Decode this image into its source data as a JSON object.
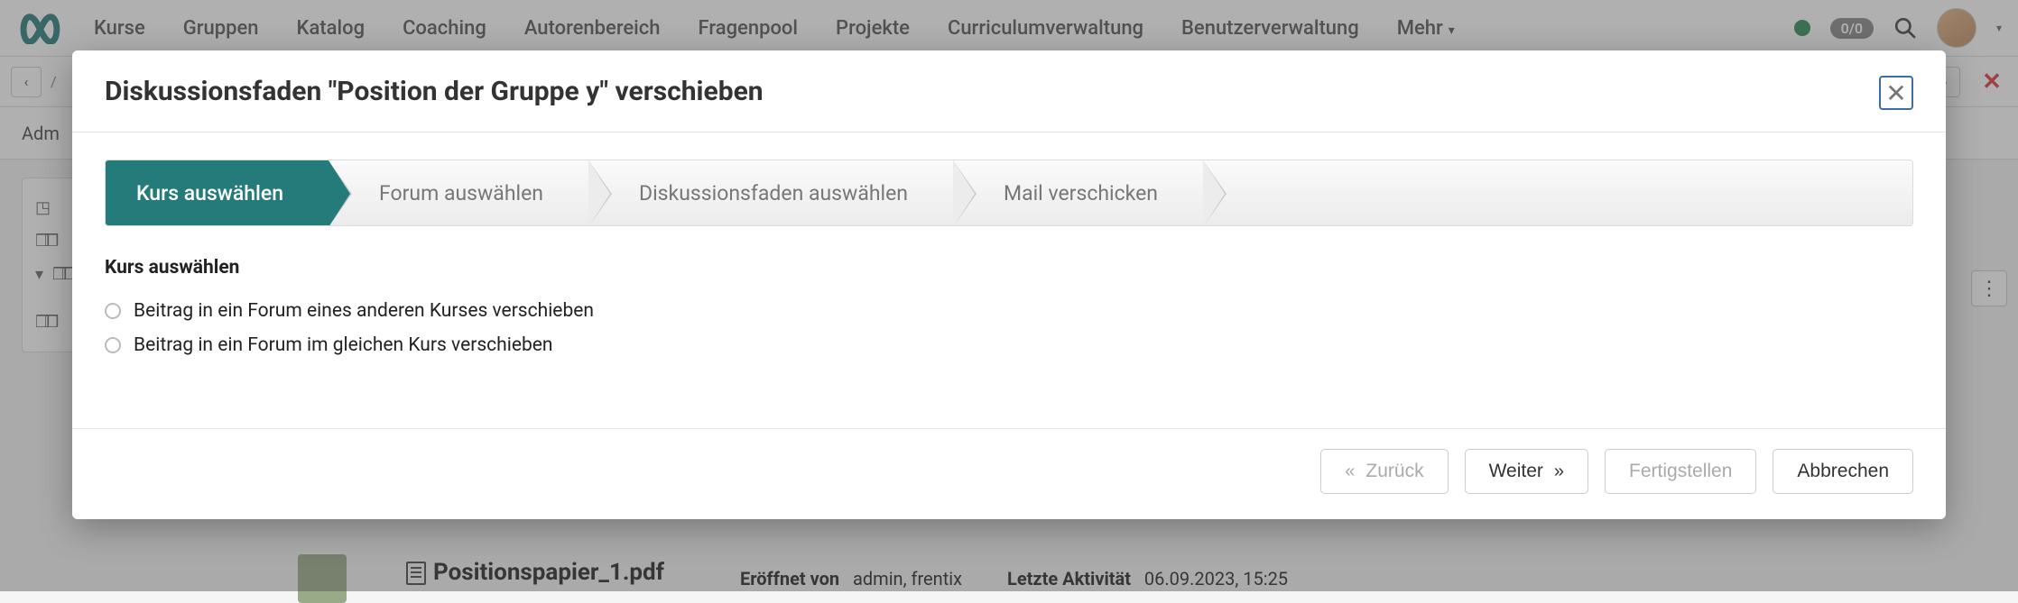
{
  "nav": {
    "items": [
      "Kurse",
      "Gruppen",
      "Katalog",
      "Coaching",
      "Autorenbereich",
      "Fragenpool",
      "Projekte",
      "Curriculumverwaltung",
      "Benutzerverwaltung"
    ],
    "more_label": "Mehr",
    "badge": "0/0"
  },
  "subbar": {
    "label": "Adm"
  },
  "background": {
    "doc_title": "Positionspapier_1.pdf",
    "opened_by_label": "Eröffnet von",
    "opened_by_value": "admin, frentix",
    "last_activity_label": "Letzte Aktivität",
    "last_activity_value": "06.09.2023, 15:25"
  },
  "modal": {
    "title": "Diskussionsfaden \"Position der Gruppe y\" verschieben",
    "steps": [
      "Kurs auswählen",
      "Forum auswählen",
      "Diskussionsfaden auswählen",
      "Mail verschicken"
    ],
    "active_step_index": 0,
    "section_heading": "Kurs auswählen",
    "options": [
      "Beitrag in ein Forum eines anderen Kurses verschieben",
      "Beitrag in ein Forum im gleichen Kurs verschieben"
    ],
    "buttons": {
      "back": "Zurück",
      "next": "Weiter",
      "finish": "Fertigstellen",
      "cancel": "Abbrechen"
    }
  }
}
